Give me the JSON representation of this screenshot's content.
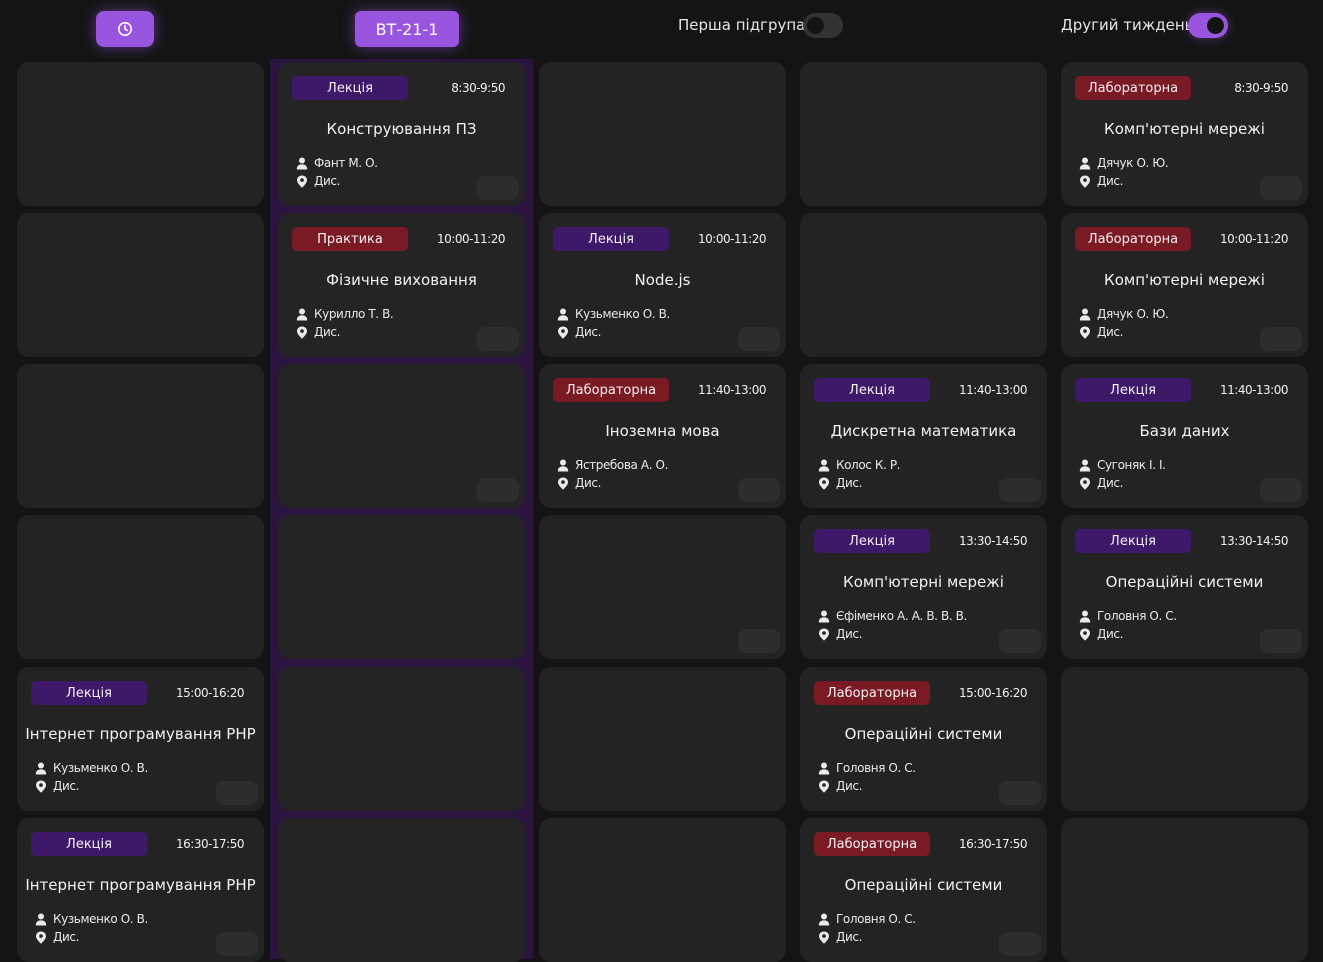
{
  "header": {
    "clock_icon": "clock-icon",
    "group_label": "ВТ-21-1",
    "subgroup_toggle_label": "Перша підгрупа",
    "subgroup_toggle_on": false,
    "week_toggle_label": "Другий тиждень",
    "week_toggle_on": true
  },
  "colors": {
    "accent": "#9a55e0",
    "lecture_badge": "#3e1869",
    "lab_badge": "#7a1a24",
    "card_bg": "#232323",
    "page_bg": "#141414"
  },
  "columns": [
    {
      "highlighted": false,
      "slots": [
        null,
        null,
        null,
        null,
        {
          "type": "lecture",
          "type_label": "Лекція",
          "time": "15:00-16:20",
          "subject": "Інтернет програмування PHP",
          "teacher": "Кузьменко О. В.",
          "room": "Дис."
        },
        {
          "type": "lecture",
          "type_label": "Лекція",
          "time": "16:30-17:50",
          "subject": "Інтернет програмування PHP",
          "teacher": "Кузьменко О. В.",
          "room": "Дис."
        }
      ]
    },
    {
      "highlighted": true,
      "slots": [
        {
          "type": "lecture",
          "type_label": "Лекція",
          "time": "8:30-9:50",
          "subject": "Конструювання ПЗ",
          "teacher": "Фант М. О.",
          "room": "Дис."
        },
        {
          "type": "practice",
          "type_label": "Практика",
          "time": "10:00-11:20",
          "subject": "Фізичне виховання",
          "teacher": "Курилло Т. В.",
          "room": "Дис."
        },
        "empty-pill",
        null,
        null,
        null
      ]
    },
    {
      "highlighted": false,
      "slots": [
        null,
        {
          "type": "lecture",
          "type_label": "Лекція",
          "time": "10:00-11:20",
          "subject": "Node.js",
          "teacher": "Кузьменко О. В.",
          "room": "Дис."
        },
        {
          "type": "lab",
          "type_label": "Лабораторна",
          "time": "11:40-13:00",
          "subject": "Іноземна мова",
          "teacher": "Ястребова А. О.",
          "room": "Дис."
        },
        "empty-pill",
        null,
        null
      ]
    },
    {
      "highlighted": false,
      "slots": [
        null,
        null,
        {
          "type": "lecture",
          "type_label": "Лекція",
          "time": "11:40-13:00",
          "subject": "Дискретна математика",
          "teacher": "Колос К. Р.",
          "room": "Дис."
        },
        {
          "type": "lecture",
          "type_label": "Лекція",
          "time": "13:30-14:50",
          "subject": "Комп'ютерні мережі",
          "teacher": "Єфіменко А. А. В. В. В.",
          "room": "Дис."
        },
        {
          "type": "lab",
          "type_label": "Лабораторна",
          "time": "15:00-16:20",
          "subject": "Операційні системи",
          "teacher": "Головня О. С.",
          "room": "Дис."
        },
        {
          "type": "lab",
          "type_label": "Лабораторна",
          "time": "16:30-17:50",
          "subject": "Операційні системи",
          "teacher": "Головня О. С.",
          "room": "Дис."
        }
      ]
    },
    {
      "highlighted": false,
      "slots": [
        {
          "type": "lab",
          "type_label": "Лабораторна",
          "time": "8:30-9:50",
          "subject": "Комп'ютерні мережі",
          "teacher": "Дячук О. Ю.",
          "room": "Дис."
        },
        {
          "type": "lab",
          "type_label": "Лабораторна",
          "time": "10:00-11:20",
          "subject": "Комп'ютерні мережі",
          "teacher": "Дячук О. Ю.",
          "room": "Дис."
        },
        {
          "type": "lecture",
          "type_label": "Лекція",
          "time": "11:40-13:00",
          "subject": "Бази даних",
          "teacher": "Сугоняк І. І.",
          "room": "Дис."
        },
        {
          "type": "lecture",
          "type_label": "Лекція",
          "time": "13:30-14:50",
          "subject": "Операційні системи",
          "teacher": "Головня О. С.",
          "room": "Дис."
        },
        null,
        null
      ]
    }
  ]
}
